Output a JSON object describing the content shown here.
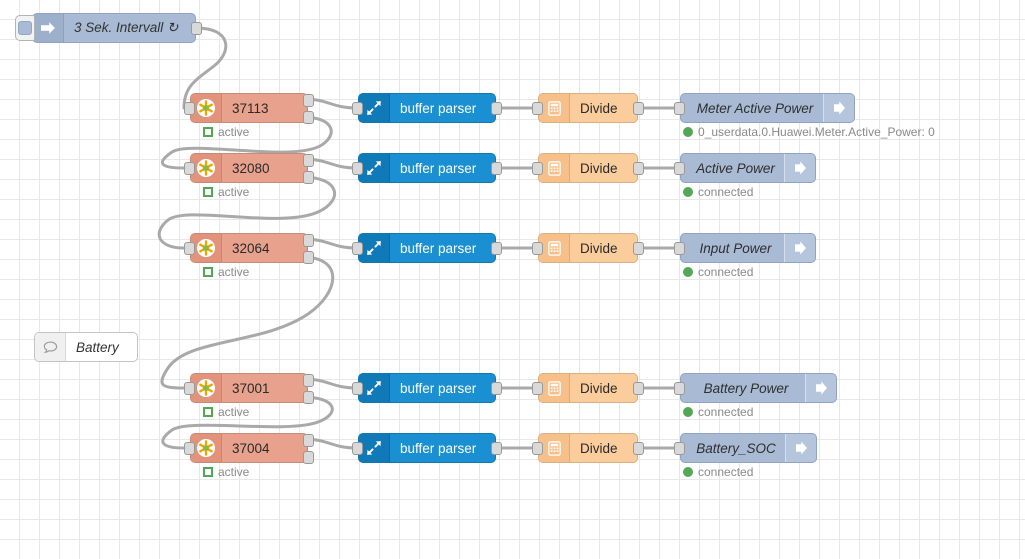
{
  "editor": {
    "name": "node-red-flow-canvas",
    "background": "#ffffff",
    "grid_color": "#e8e8e8",
    "wire_color": "#a9a9a9"
  },
  "palette": {
    "inject": "#a8bad4",
    "modbus": "#e8a18c",
    "buffer_parser": "#1a8fd1",
    "divide": "#fbcd9d",
    "output": "#a8bad4",
    "comment": "#ffffff",
    "status_green": "#53a653"
  },
  "nodes": {
    "inject": {
      "label": "3 Sek. Intervall ↻",
      "icon": "inject-arrow-icon",
      "button_name": "inject-trigger-button"
    },
    "comment": {
      "label": "Battery",
      "icon": "comment-bubble-icon"
    }
  },
  "flows": [
    {
      "modbus": {
        "label": "37113",
        "icon": "modbus-flexgetter-icon",
        "status": "active",
        "status_type": "square"
      },
      "parser": {
        "label": "buffer parser",
        "icon": "expand-arrows-icon"
      },
      "divide": {
        "label": "Divide",
        "icon": "calculator-icon"
      },
      "output": {
        "label": "Meter Active Power",
        "icon": "iobroker-out-arrow-icon",
        "status": "0_userdata.0.Huawei.Meter.Active_Power: 0",
        "status_type": "dot"
      }
    },
    {
      "modbus": {
        "label": "32080",
        "icon": "modbus-flexgetter-icon",
        "status": "active",
        "status_type": "square"
      },
      "parser": {
        "label": "buffer parser",
        "icon": "expand-arrows-icon"
      },
      "divide": {
        "label": "Divide",
        "icon": "calculator-icon"
      },
      "output": {
        "label": "Active Power",
        "icon": "iobroker-out-arrow-icon",
        "status": "connected",
        "status_type": "dot"
      }
    },
    {
      "modbus": {
        "label": "32064",
        "icon": "modbus-flexgetter-icon",
        "status": "active",
        "status_type": "square"
      },
      "parser": {
        "label": "buffer parser",
        "icon": "expand-arrows-icon"
      },
      "divide": {
        "label": "Divide",
        "icon": "calculator-icon"
      },
      "output": {
        "label": "Input Power",
        "icon": "iobroker-out-arrow-icon",
        "status": "connected",
        "status_type": "dot"
      }
    },
    {
      "modbus": {
        "label": "37001",
        "icon": "modbus-flexgetter-icon",
        "status": "active",
        "status_type": "square"
      },
      "parser": {
        "label": "buffer parser",
        "icon": "expand-arrows-icon"
      },
      "divide": {
        "label": "Divide",
        "icon": "calculator-icon"
      },
      "output": {
        "label": "Battery Power",
        "icon": "iobroker-out-arrow-icon",
        "status": "connected",
        "status_type": "dot"
      }
    },
    {
      "modbus": {
        "label": "37004",
        "icon": "modbus-flexgetter-icon",
        "status": "active",
        "status_type": "square"
      },
      "parser": {
        "label": "buffer parser",
        "icon": "expand-arrows-icon"
      },
      "divide": {
        "label": "Divide",
        "icon": "calculator-icon"
      },
      "output": {
        "label": "Battery_SOC",
        "icon": "iobroker-out-arrow-icon",
        "status": "connected",
        "status_type": "dot"
      }
    }
  ]
}
